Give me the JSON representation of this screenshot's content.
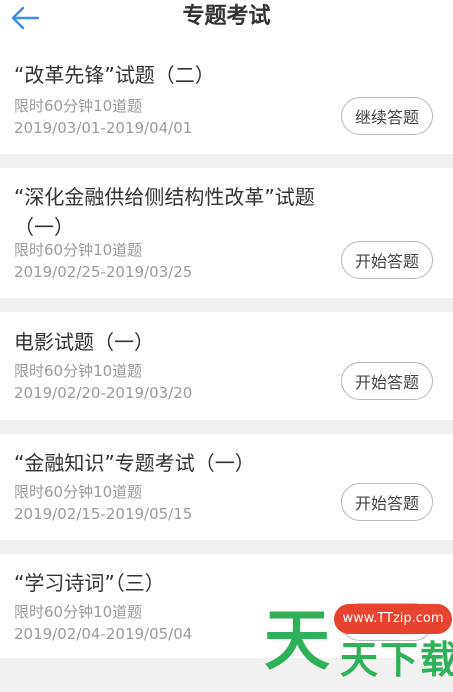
{
  "header": {
    "title": "专题考试",
    "back_icon": "arrow-left-icon"
  },
  "exams": [
    {
      "title": "“改革先锋”试题（二）",
      "limit": "限时60分钟10道题",
      "date_range": "2019/03/01-2019/04/01",
      "button": "继续答题"
    },
    {
      "title": "“深化金融供给侧结构性改革”试题（一）",
      "limit": "限时60分钟10道题",
      "date_range": "2019/02/25-2019/03/25",
      "button": "开始答题"
    },
    {
      "title": "电影试题（一）",
      "limit": "限时60分钟10道题",
      "date_range": "2019/02/20-2019/03/20",
      "button": "开始答题"
    },
    {
      "title": "“金融知识”专题考试（一）",
      "limit": "限时60分钟10道题",
      "date_range": "2019/02/15-2019/05/15",
      "button": "开始答题"
    },
    {
      "title": "“学习诗词”（三）",
      "limit": "限时60分钟10道题",
      "date_range": "2019/02/04-2019/05/04",
      "button": ""
    }
  ],
  "watermark": {
    "url": "www.TTzip.com",
    "text": "天下载"
  },
  "colors": {
    "accent": "#3a8ee6",
    "gap": "#f1f1f1",
    "meta": "#9b9b9b",
    "watermark_green": "#2fb15a",
    "watermark_red": "#e8432e"
  }
}
